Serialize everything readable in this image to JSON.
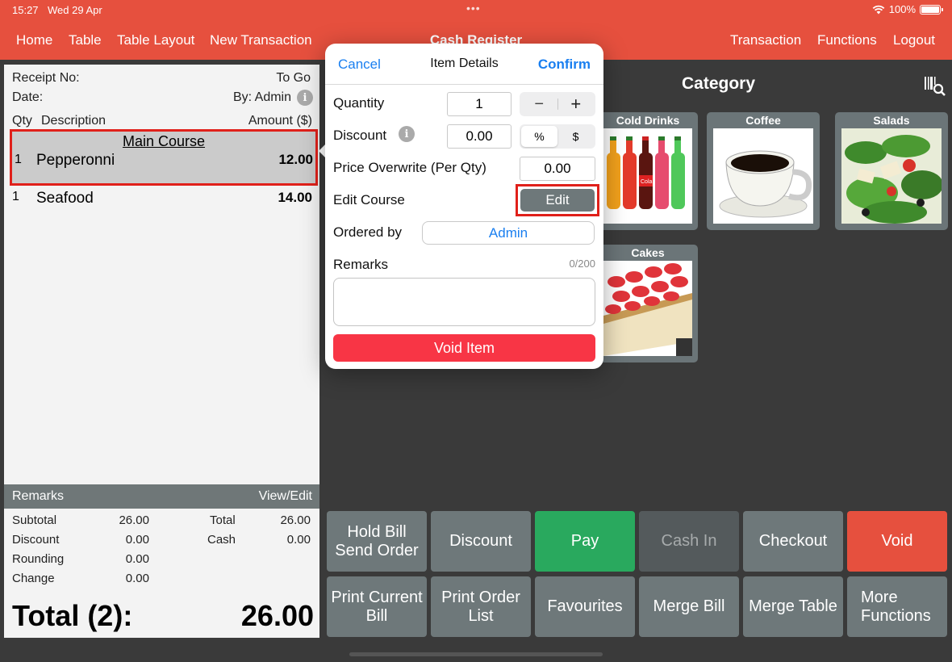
{
  "status": {
    "time": "15:27",
    "date": "Wed 29 Apr",
    "battery": "100%"
  },
  "nav": {
    "left": [
      "Home",
      "Table",
      "Table Layout",
      "New Transaction"
    ],
    "title": "Cash Register",
    "right": [
      "Transaction",
      "Functions",
      "Logout"
    ]
  },
  "receipt": {
    "receipt_no_label": "Receipt No:",
    "order_type": "To Go",
    "date_label": "Date:",
    "by": "By: Admin",
    "columns": {
      "qty": "Qty",
      "description": "Description",
      "amount": "Amount ($)"
    },
    "course_header": "Main Course",
    "items": [
      {
        "qty": "1",
        "name": "Pepperonni",
        "amount": "12.00"
      },
      {
        "qty": "1",
        "name": "Seafood",
        "amount": "14.00"
      }
    ],
    "remarks_label": "Remarks",
    "remarks_action": "View/Edit",
    "totals": {
      "subtotal_label": "Subtotal",
      "subtotal": "26.00",
      "discount_label": "Discount",
      "discount": "0.00",
      "rounding_label": "Rounding",
      "rounding": "0.00",
      "change_label": "Change",
      "change": "0.00",
      "total_label": "Total",
      "total": "26.00",
      "cash_label": "Cash",
      "cash": "0.00"
    },
    "grand_total_label": "Total (2):",
    "grand_total": "26.00"
  },
  "popover": {
    "cancel": "Cancel",
    "title": "Item Details",
    "confirm": "Confirm",
    "quantity_label": "Quantity",
    "quantity": "1",
    "minus": "−",
    "plus": "+",
    "discount_label": "Discount",
    "discount": "0.00",
    "percent": "%",
    "dollar": "$",
    "price_overwrite_label": "Price Overwrite (Per Qty)",
    "price_overwrite": "0.00",
    "edit_course_label": "Edit Course",
    "edit_button": "Edit",
    "ordered_by_label": "Ordered by",
    "ordered_by": "Admin",
    "remarks_label": "Remarks",
    "remarks_count": "0/200",
    "void_item": "Void Item"
  },
  "category": {
    "title": "Category",
    "tiles": [
      {
        "label": "Cold Drinks",
        "icon": "soda-bottles-image"
      },
      {
        "label": "Coffee",
        "icon": "coffee-cup-image"
      },
      {
        "label": "Salads",
        "icon": "salad-image"
      },
      {
        "label": "Cakes",
        "icon": "strawberry-cake-image"
      }
    ]
  },
  "functions": {
    "hold_bill_line1": "Hold Bill",
    "hold_bill_line2": "Send Order",
    "discount": "Discount",
    "pay": "Pay",
    "cash_in": "Cash In",
    "checkout": "Checkout",
    "void": "Void",
    "print_bill_line1": "Print Current",
    "print_bill_line2": "Bill",
    "print_order_line1": "Print Order",
    "print_order_line2": "List",
    "favourites": "Favourites",
    "merge_bill": "Merge Bill",
    "merge_table": "Merge Table",
    "more_line1": "More",
    "more_line2": "Functions"
  },
  "colors": {
    "header": "#e6503e",
    "background": "#3a3a3a",
    "tile": "#6e787a",
    "pay": "#29a95e",
    "void": "#e6503e",
    "link": "#1a7ff0",
    "void_item": "#f83545",
    "highlight": "#e0201a"
  }
}
